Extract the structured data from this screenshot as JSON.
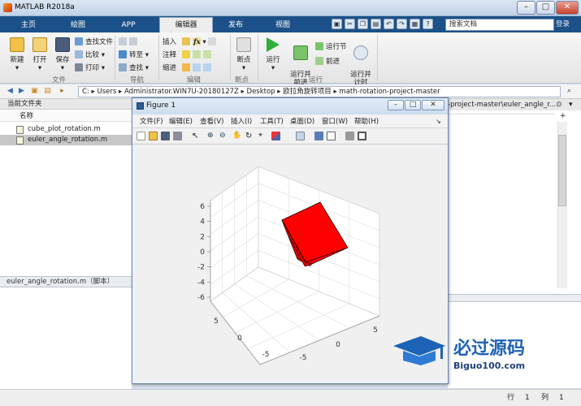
{
  "app": {
    "title": "MATLAB R2018a"
  },
  "window_controls": [
    "–",
    "□",
    "✕"
  ],
  "tabs": [
    {
      "label": "主页"
    },
    {
      "label": "绘图"
    },
    {
      "label": "APP"
    },
    {
      "label": "编辑器"
    },
    {
      "label": "发布"
    },
    {
      "label": "视图"
    }
  ],
  "search": {
    "placeholder": "搜索文档",
    "login": "登录"
  },
  "ribbon": {
    "file": {
      "new": "新建",
      "open": "打开",
      "save": "保存",
      "find_files": "查找文件",
      "compare": "比较",
      "print": "打印",
      "group": "文件"
    },
    "nav": {
      "goto": "转至",
      "find": "查找",
      "group": "导航"
    },
    "edit": {
      "insert": "插入",
      "comment": "注释",
      "indent": "缩进",
      "fx": "fx",
      "group": "编辑"
    },
    "breakpoints": {
      "label": "断点",
      "group": "断点"
    },
    "run": {
      "run": "运行",
      "run_advance": "运行并\n前进",
      "run_section": "运行节",
      "advance": "前进",
      "run_time": "运行并\n计时",
      "group": "运行"
    }
  },
  "address": {
    "path": "C: ▸ Users ▸ Administrator.WIN7U-20180127Z ▸ Desktop ▸ 欧拉角旋转项目 ▸ math-rotation-project-master"
  },
  "left_panel": {
    "title": "当前文件夹",
    "column": "名称",
    "files": [
      {
        "name": "cube_plot_rotation.m",
        "selected": false
      },
      {
        "name": "euler_angle_rotation.m",
        "selected": true
      }
    ],
    "details": "euler_angle_rotation.m（脚本）"
  },
  "right_panel": {
    "title": "-project-master\\euler_angle_r..."
  },
  "status": {
    "row_label": "行",
    "row": "1",
    "col_label": "列",
    "col": "1"
  },
  "figure": {
    "title": "Figure 1",
    "menu": [
      "文件(F)",
      "编辑(E)",
      "查看(V)",
      "插入(I)",
      "工具(T)",
      "桌面(D)",
      "窗口(W)",
      "帮助(H)"
    ]
  },
  "chart_data": {
    "type": "3d-surface",
    "title": "",
    "z_ticks": [
      "6",
      "4",
      "2",
      "0",
      "-2",
      "-4",
      "-6"
    ],
    "x_ticks": [
      "5",
      "0",
      "-5"
    ],
    "y_ticks": [
      "5",
      "0",
      "-5"
    ],
    "zlim": [
      -6,
      6
    ],
    "grid": true,
    "object": "rotated cube",
    "colors": {
      "face": "#ff0000",
      "edge": "#000000"
    }
  },
  "watermark": {
    "text_cn": "必过源码",
    "text_url": "Biguo100.com"
  }
}
